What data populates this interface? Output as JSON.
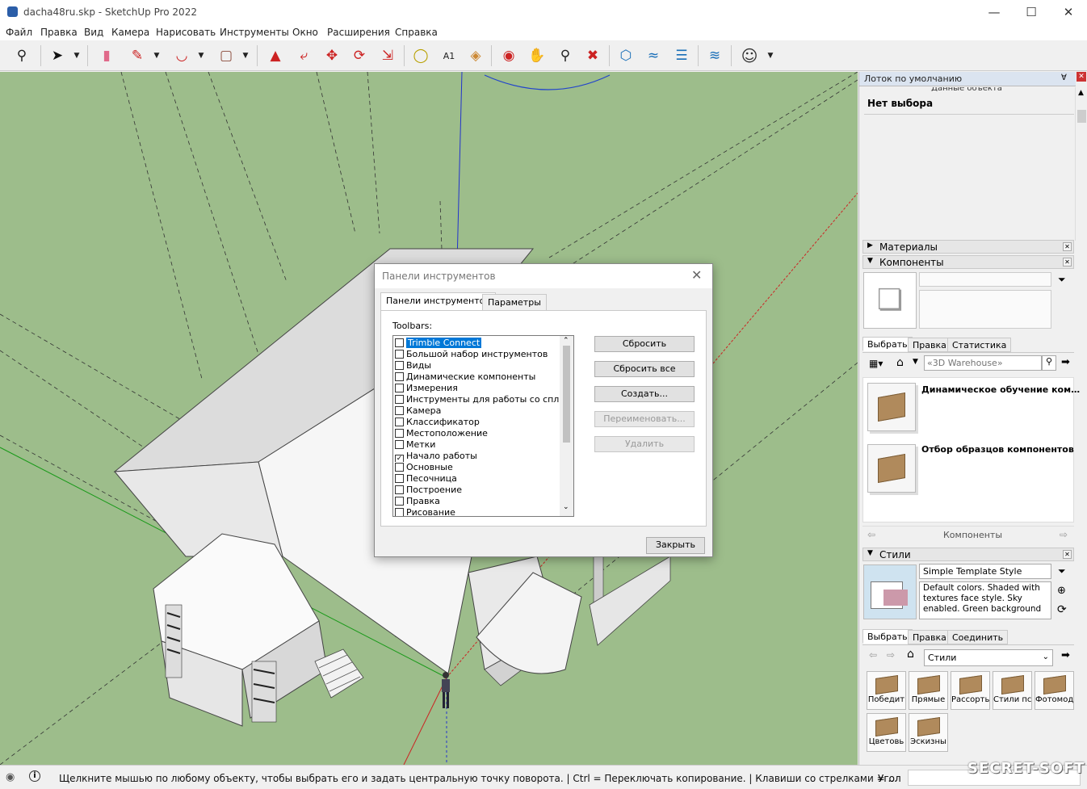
{
  "window": {
    "title": "dacha48ru.skp - SketchUp Pro 2022",
    "minimize": "—",
    "maximize": "☐",
    "close": "✕"
  },
  "menu": [
    "Файл",
    "Правка",
    "Вид",
    "Камера",
    "Нарисовать",
    "Инструменты",
    "Окно",
    "Расширения",
    "Справка"
  ],
  "toolbar_icons": [
    "zoom-extents-icon",
    "select-icon",
    "eraser-icon",
    "pencil-icon",
    "arc-icon",
    "rectangle-icon",
    "push-pull-icon",
    "follow-me-icon",
    "move-icon",
    "rotate-icon",
    "scale-icon",
    "tape-measure-icon",
    "text-icon",
    "paint-bucket-icon",
    "orbit-icon",
    "pan-icon",
    "zoom-icon",
    "zoom-window-icon",
    "trimble-connect-icon",
    "layers-icon",
    "sync-icon",
    "extension-icon",
    "account-icon"
  ],
  "tray": {
    "title": "Лоток по умолчанию",
    "entity_info_header": "Данные объекта",
    "no_selection": "Нет выбора",
    "materials": "Материалы",
    "components": "Компоненты",
    "comp_tabs": [
      "Выбрать",
      "Правка",
      "Статистика"
    ],
    "comp_search_placeholder": "«3D Warehouse»",
    "comp_items": [
      "Динамическое обучение ком…",
      "Отбор образцов компонентов"
    ],
    "comp_footer": "Компоненты",
    "styles": "Стили",
    "style_name": "Simple Template Style",
    "style_desc": "Default colors.  Shaded with textures face style.  Sky enabled.  Green background",
    "style_tabs": [
      "Выбрать",
      "Правка",
      "Соединить"
    ],
    "style_dropdown": "Стили",
    "style_thumbs": [
      "Победит",
      "Прямые",
      "Рассорть",
      "Стили пс",
      "Фотомод",
      "Цветовь",
      "Эскизны"
    ]
  },
  "dialog": {
    "title": "Панели инструментов",
    "tabs": [
      "Панели инструментов",
      "Параметры"
    ],
    "toolbars_label": "Toolbars:",
    "items": [
      {
        "label": "Trimble Connect",
        "checked": false,
        "selected": true
      },
      {
        "label": "Большой набор инструментов",
        "checked": false
      },
      {
        "label": "Виды",
        "checked": false
      },
      {
        "label": "Динамические компоненты",
        "checked": false
      },
      {
        "label": "Измерения",
        "checked": false
      },
      {
        "label": "Инструменты для работы со сплошными",
        "checked": false
      },
      {
        "label": "Камера",
        "checked": false
      },
      {
        "label": "Классификатор",
        "checked": false
      },
      {
        "label": "Местоположение",
        "checked": false
      },
      {
        "label": "Метки",
        "checked": false
      },
      {
        "label": "Начало работы",
        "checked": true
      },
      {
        "label": "Основные",
        "checked": false
      },
      {
        "label": "Песочница",
        "checked": false
      },
      {
        "label": "Построение",
        "checked": false
      },
      {
        "label": "Правка",
        "checked": false
      },
      {
        "label": "Рисование",
        "checked": false
      }
    ],
    "buttons": {
      "reset": "Сбросить",
      "reset_all": "Сбросить все",
      "create": "Создать...",
      "rename": "Переименовать...",
      "delete": "Удалить",
      "close": "Закрыть"
    }
  },
  "status": {
    "text": "Щелкните мышью по любому объекту, чтобы выбрать его и задать центральную точку поворота. | Ctrl = Переключать копирование. | Клавиши со стрелками = ...",
    "angle_label": "Угол",
    "watermark": "SECRET-SOFT"
  },
  "colors": {
    "viewport_bg": "#9dbd8b",
    "selection": "#0078d7",
    "brand": "#2b5ea8"
  }
}
